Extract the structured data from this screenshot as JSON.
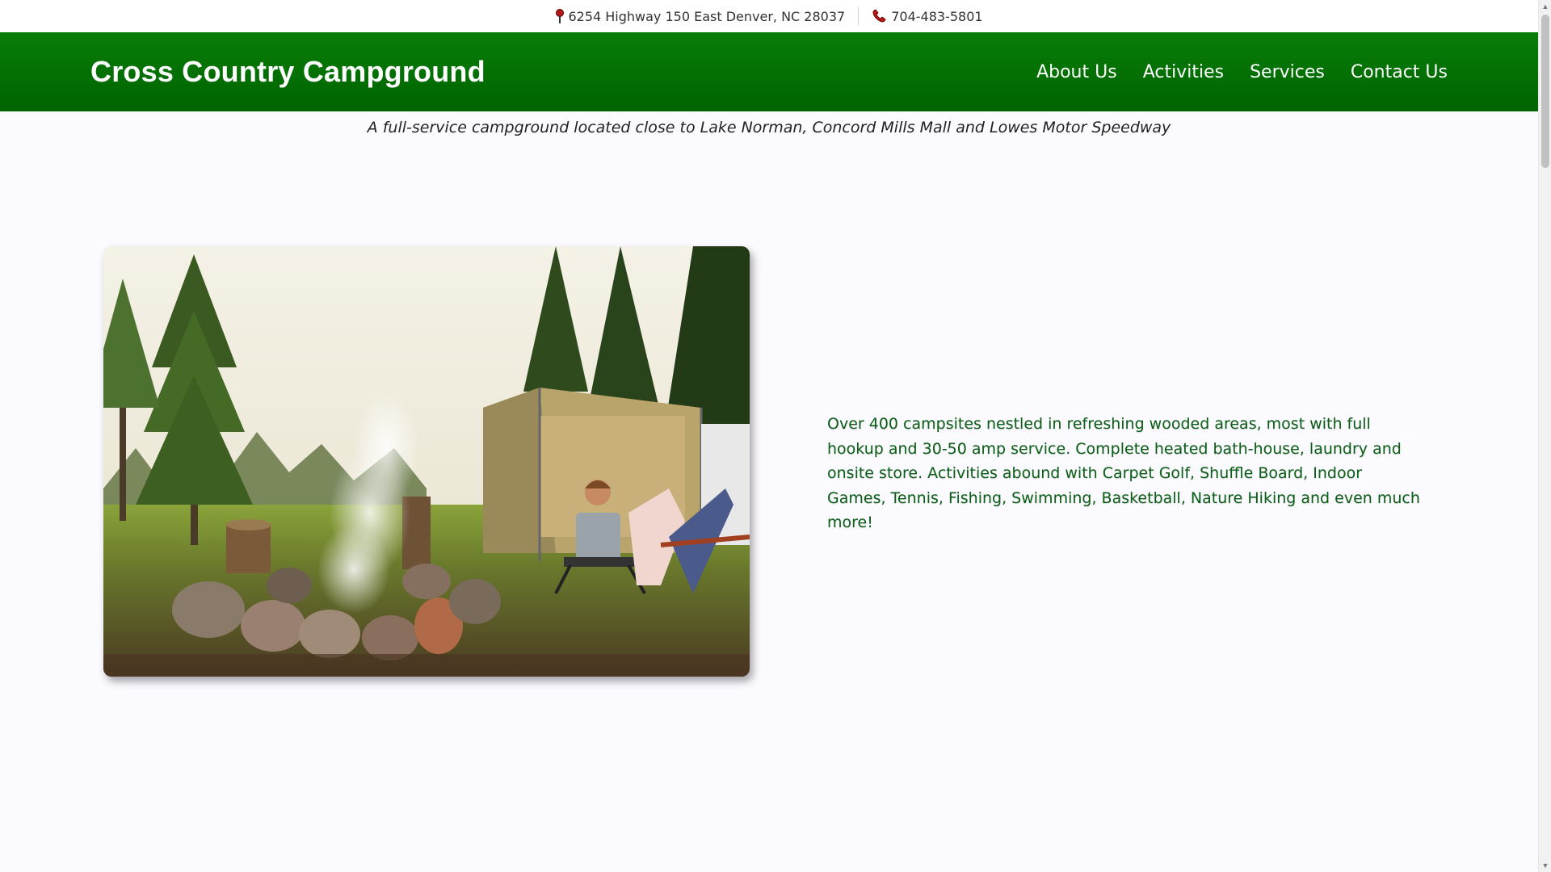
{
  "topbar": {
    "address": "6254 Highway 150 East Denver, NC 28037",
    "phone": "704-483-5801",
    "address_icon": "map-pin-icon",
    "phone_icon": "phone-icon"
  },
  "header": {
    "site_title": "Cross Country Campground",
    "background_color": "#007a06",
    "nav": [
      {
        "label": "About Us"
      },
      {
        "label": "Activities"
      },
      {
        "label": "Services"
      },
      {
        "label": "Contact Us"
      }
    ]
  },
  "tagline": "A full-service campground located close to Lake Norman, Concord Mills Mall and Lowes Motor Speedway",
  "main": {
    "description": "Over 400 campsites nestled in refreshing wooded areas, most with full hookup and 30-50 amp service. Complete heated bath-house, laundry and onsite store. Activities abound with Carpet Golf, Shuffle Board, Indoor Games, Tennis, Fishing, Swimming, Basketball, Nature Hiking and even much more!",
    "description_color": "#0c5f16"
  }
}
